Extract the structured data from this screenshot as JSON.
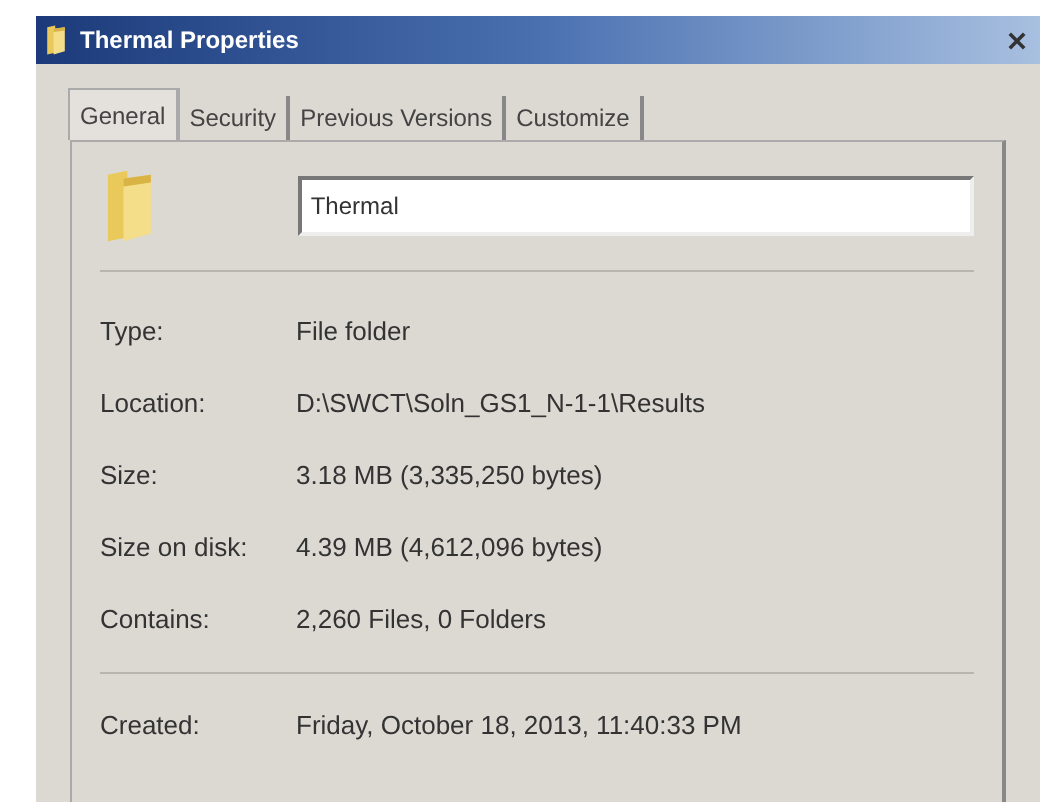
{
  "window": {
    "title": "Thermal Properties"
  },
  "tabs": [
    {
      "label": "General",
      "selected": true
    },
    {
      "label": "Security",
      "selected": false
    },
    {
      "label": "Previous Versions",
      "selected": false
    },
    {
      "label": "Customize",
      "selected": false
    }
  ],
  "name_field": {
    "value": "Thermal"
  },
  "properties": [
    {
      "label": "Type:",
      "value": "File folder"
    },
    {
      "label": "Location:",
      "value": "D:\\SWCT\\Soln_GS1_N-1-1\\Results"
    },
    {
      "label": "Size:",
      "value": "3.18 MB (3,335,250 bytes)"
    },
    {
      "label": "Size on disk:",
      "value": "4.39 MB (4,612,096 bytes)"
    },
    {
      "label": "Contains:",
      "value": "2,260 Files, 0 Folders"
    }
  ],
  "dates": [
    {
      "label": "Created:",
      "value": "Friday, October 18, 2013, 11:40:33 PM"
    }
  ]
}
